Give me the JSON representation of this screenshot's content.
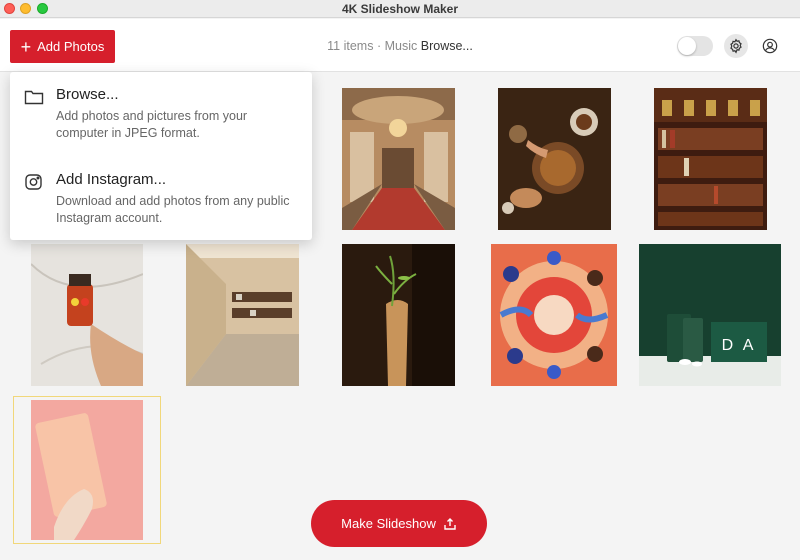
{
  "window": {
    "title": "4K Slideshow Maker"
  },
  "toolbar": {
    "add_label": "Add Photos",
    "items_count": "11 items",
    "separator": "·",
    "music_label": "Music",
    "music_value": "Browse...",
    "toggle_on": false
  },
  "menu": {
    "items": [
      {
        "title": "Browse...",
        "description": "Add photos and pictures from your computer in JPEG format.",
        "icon": "folder-icon"
      },
      {
        "title": "Add Instagram...",
        "description": "Download and add photos from any public Instagram account.",
        "icon": "instagram-icon"
      }
    ]
  },
  "photos": [
    {
      "id": "palace-staircase",
      "subject": "palace-staircase"
    },
    {
      "id": "tea-table",
      "subject": "tea-table"
    },
    {
      "id": "bookshelf",
      "subject": "bookshelf"
    },
    {
      "id": "jar-in-hand",
      "subject": "jar-in-hand"
    },
    {
      "id": "store-corridor",
      "subject": "store-corridor"
    },
    {
      "id": "plant-vase",
      "subject": "plant-vase"
    },
    {
      "id": "people-circle-illustration",
      "subject": "people-circle-illustration"
    },
    {
      "id": "da-product-box",
      "subject": "da-product-box",
      "text": "D A"
    },
    {
      "id": "hand-pink-package",
      "subject": "hand-pink-package",
      "selected": true
    }
  ],
  "footer": {
    "make_label": "Make Slideshow"
  },
  "colors": {
    "accent": "#d61f2c",
    "selection": "#f1d77a"
  }
}
